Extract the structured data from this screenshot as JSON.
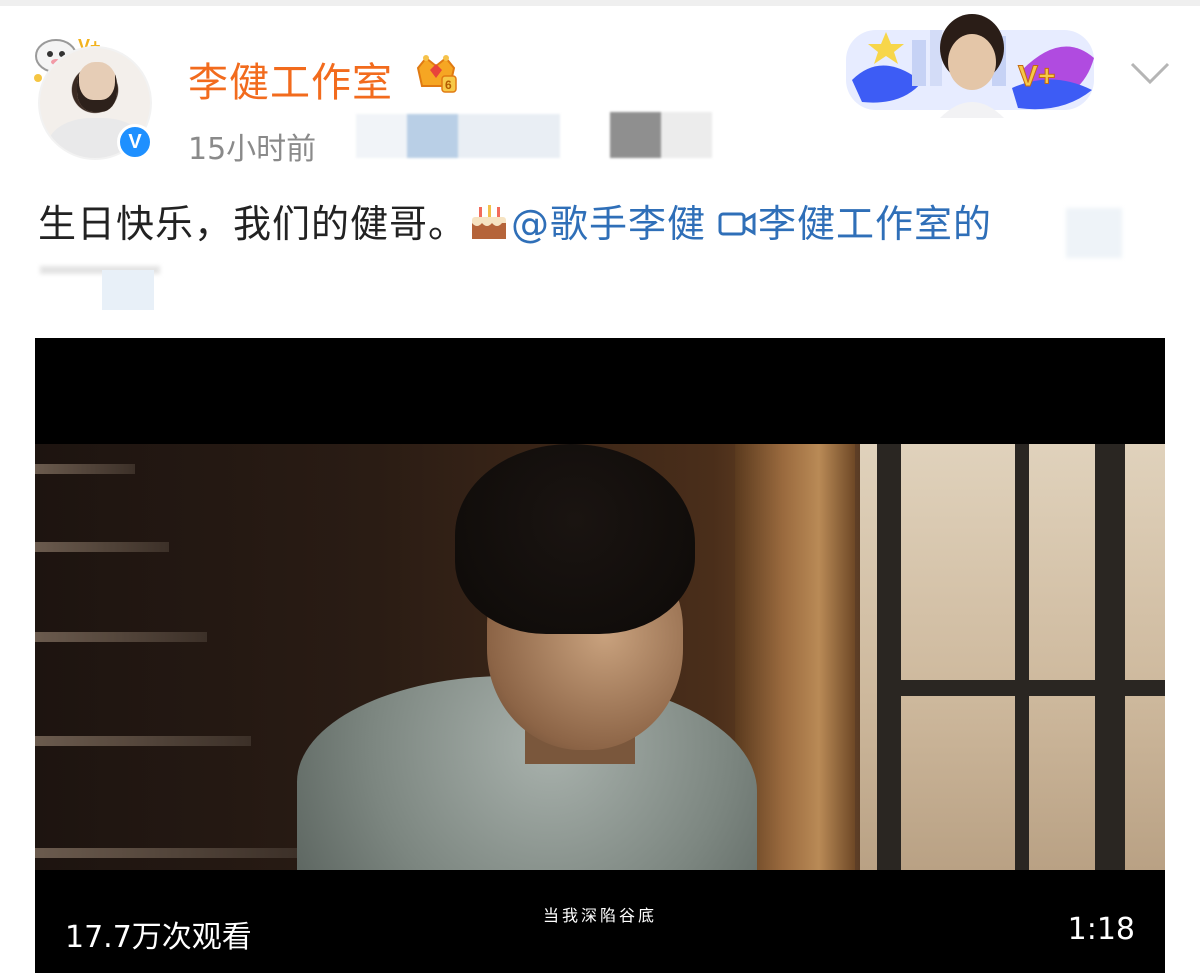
{
  "post": {
    "author_name": "李健工作室",
    "timestamp": "15小时前",
    "verified_mark": "V",
    "text_main": "生日快乐，我们的健哥。",
    "mention": "@歌手李健",
    "video_link": "李健工作室的",
    "crown_badge_digit": "6",
    "banner_badge": "V+"
  },
  "video": {
    "views": "17.7万次观看",
    "subtitle": "当我深陷谷底",
    "duration": "1:18"
  },
  "colors": {
    "author_name": "#f26b1d",
    "link": "#2f6fb8",
    "verified": "#1e90ff",
    "timestamp": "#8a8a8a"
  },
  "icons": [
    "cartoon-deco-icon",
    "verified-icon",
    "crown-icon",
    "cake-icon",
    "camera-icon",
    "chevron-down-icon"
  ]
}
